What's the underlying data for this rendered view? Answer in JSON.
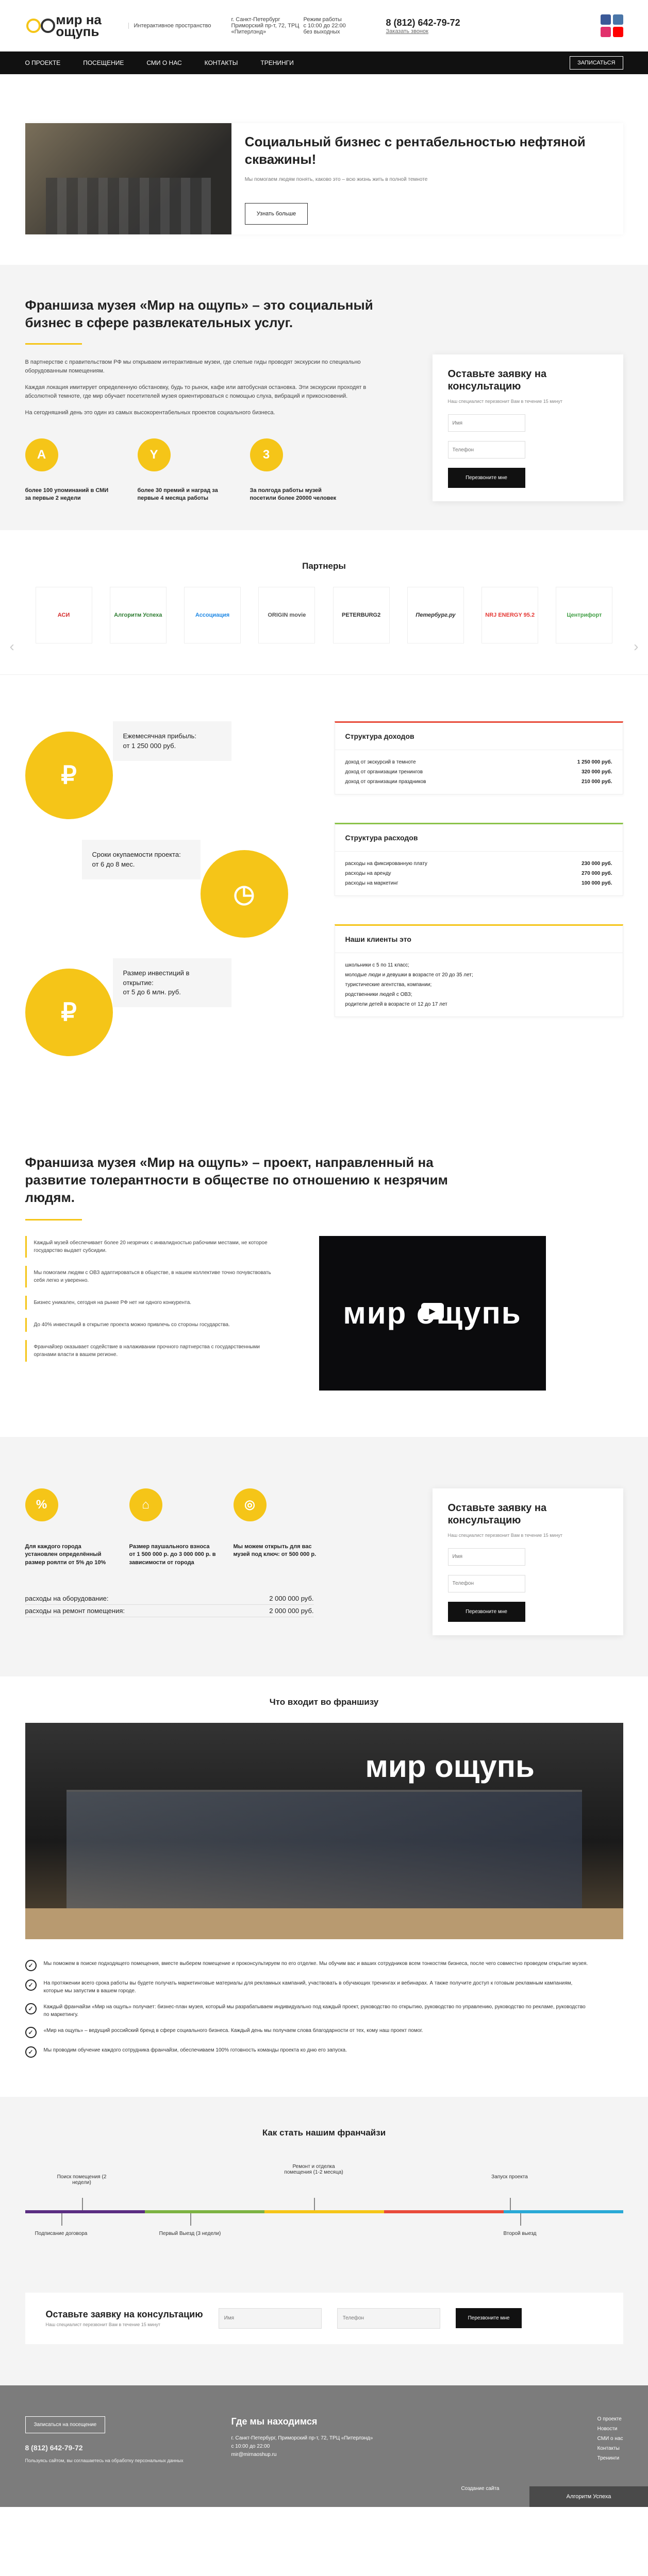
{
  "header": {
    "logo_text": "мир на ощупь",
    "slogan": "Интерактивное пространство",
    "address_city": "г. Санкт-Петербург",
    "address_street": "Приморский пр-т, 72, ТРЦ «Питерлэнд»",
    "hours_label": "Режим работы",
    "hours_value": "с 10:00 до 22:00",
    "hours_extra": "без выходных",
    "phone": "8 (812) 642-79-72",
    "callback_link": "Заказать звонок",
    "social_colors": [
      "#3b5998",
      "#4a76a8",
      "#e1306c",
      "#ff0000"
    ]
  },
  "nav": {
    "items": [
      "О проекте",
      "Посещение",
      "СМИ о нас",
      "Контакты",
      "Тренинги"
    ],
    "call_button": "Записаться"
  },
  "hero": {
    "title": "Социальный бизнес с рентабельностью нефтяной скважины!",
    "subtitle": "Мы помогаем людям понять, каково это – всю жизнь жить в полной темноте",
    "button": "Узнать больше"
  },
  "franchise": {
    "title": "Франшиза музея «Мир на ощупь» – это социальный бизнес в сфере развлекательных услуг.",
    "p1": "В партнерстве с правительством РФ мы открываем интерактивные музеи, где слепые гиды проводят экскурсии по специально оборудованным помещениям.",
    "p2": "Каждая локация имитирует определенную обстановку, будь то рынок, кафе или автобусная остановка. Эти экскурсии проходят в абсолютной темноте, где мир обучает посетителей музея ориентироваться с помощью слуха, вибраций и прикосновений.",
    "p3": "На сегодняшний день это один из самых высокорентабельных проектов социального бизнеса.",
    "stats": [
      {
        "icon": "А",
        "text": "более 100 упоминаний в СМИ за первые 2 недели"
      },
      {
        "icon": "Y",
        "text": "более 30 премий и наград за первые 4 месяца работы"
      },
      {
        "icon": "3",
        "text": "За полгода работы музей посетили более 20000 человек"
      }
    ]
  },
  "form": {
    "title": "Оставьте заявку на консультацию",
    "subtitle": "Наш специалист перезвонит Вам в течение 15 минут",
    "name_placeholder": "Имя",
    "phone_placeholder": "Телефон",
    "send": "Перезвоните мне"
  },
  "partners": {
    "title": "Партнеры",
    "items": [
      "АСИ",
      "Алгоритм Успеха",
      "Ассоциация",
      "ORIGIN movie",
      "PETERBURG2",
      "Петербург.ру",
      "NRJ ENERGY 95.2",
      "Центрифорт"
    ]
  },
  "income": {
    "blocks": [
      {
        "label": "Ежемесячная прибыль:",
        "value": "от 1 250 000 руб.",
        "icon": "₽"
      },
      {
        "label": "Сроки окупаемости проекта:",
        "value": "от 6 до 8 мес.",
        "icon": "◷"
      },
      {
        "label": "Размер инвестиций в открытие:",
        "value": "от 5 до 6 млн. руб.",
        "icon": "₽"
      }
    ],
    "revenue": {
      "title": "Структура доходов",
      "rows": [
        {
          "k": "доход от экскурсий в темноте",
          "v": "1 250 000 руб."
        },
        {
          "k": "доход от организации тренингов",
          "v": "320 000 руб."
        },
        {
          "k": "доход от организации праздников",
          "v": "210 000 руб."
        }
      ]
    },
    "expenses": {
      "title": "Структура расходов",
      "rows": [
        {
          "k": "расходы на фиксированную плату",
          "v": "230 000 руб."
        },
        {
          "k": "расходы на аренду",
          "v": "270 000 руб."
        },
        {
          "k": "расходы на маркетинг",
          "v": "100 000 руб."
        }
      ]
    },
    "clients": {
      "title": "Наши клиенты это",
      "rows": [
        "школьники с 5 по 11 класс;",
        "молодые люди и девушки в возрасте от 20 до 35 лет;",
        "туристические агентства, компании;",
        "родственники людей с ОВЗ;",
        "родители детей в возрасте от 12 до 17 лет"
      ]
    }
  },
  "social": {
    "title": "Франшиза музея «Мир на ощупь» – проект, направленный на развитие толерантности в обществе по отношению к незрячим людям.",
    "items": [
      "Каждый музей обеспечивает более 20 незрячих с инвалидностью рабочими местами, не которое государство выдает субсидии.",
      "Мы помогаем людям с ОВЗ адаптироваться в обществе, в нашем коллективе точно почувствовать себя легко и уверенно.",
      "Бизнес уникален, сегодня на рынке РФ нет ни одного конкурента.",
      "До 40% инвестиций в открытие проекта можно привлечь со стороны государства.",
      "Франчайзер оказывает содействие в налаживании прочного партнерства с государственными органами власти в вашем регионе."
    ],
    "video_logo": "мир ощупь"
  },
  "invest": {
    "stats": [
      {
        "icon": "%",
        "text": "Для каждого города установлен определённый размер роялти от 5% до 10%"
      },
      {
        "icon": "⌂",
        "text": "Размер паушального взноса от 1 500 000 р. до 3 000 000 р. в зависимости от города"
      },
      {
        "icon": "◎",
        "text": "Мы можем открыть для вас музей под ключ: от 500 000 р."
      }
    ],
    "rows": [
      {
        "k": "расходы на оборудование:",
        "v": "2 000 000 руб."
      },
      {
        "k": "расходы на ремонт помещения:",
        "v": "2 000 000 руб."
      }
    ]
  },
  "included": {
    "title": "Что входит во франшизу",
    "store_sign": "мир ощупь",
    "items": [
      "Мы поможем в поиске подходящего помещения, вместе выберем помещение и проконсультируем по его отделке. Мы обучим вас и ваших сотрудников всем тонкостям бизнеса, после чего совместно проведем открытие музея.",
      "На протяжении всего срока работы вы будете получать маркетинговые материалы для рекламных кампаний, участвовать в обучающих тренингах и вебинарах. А также получите доступ к готовым рекламным кампаниям, которые мы запустим в вашем городе.",
      "Каждый франчайзи «Мир на ощупь» получает: бизнес-план музея, который мы разрабатываем индивидуально под каждый проект, руководство по открытию, руководство по управлению, руководство по рекламе, руководство по маркетингу.",
      "«Мир на ощупь» – ведущий российский бренд в сфере социального бизнеса. Каждый день мы получаем слова благодарности от тех, кому наш проект помог.",
      "Мы проводим обучение каждого сотрудника франчайзи, обеспечиваем 100% готовность команды проекта ко дню его запуска."
    ]
  },
  "stages": {
    "title": "Как стать нашим франчайзи",
    "top": [
      "Поиск помещения (2 недели)",
      "Ремонт и отделка помещения (1-2 месяца)",
      "Запуск проекта"
    ],
    "bottom": [
      "Подписание договора",
      "Первый Выезд (3 недели)",
      "Второй выезд"
    ]
  },
  "footer_form": {
    "title": "Оставьте заявку на консультацию",
    "subtitle": "Наш специалист перезвонит Вам в течение 15 минут",
    "name_placeholder": "Имя",
    "phone_placeholder": "Телефон",
    "send": "Перезвоните мне"
  },
  "footer": {
    "call_button": "Записаться на посещение",
    "phone": "8 (812) 642-79-72",
    "note": "Пользуясь сайтом, вы соглашаетесь на обработку персональных данных",
    "where_title": "Где мы находимся",
    "where_text": "г. Санкт-Петербург, Приморский пр-т, 72, ТРЦ «Питерлэнд»",
    "hours": "с 10:00 до 22:00",
    "email": "mir@mirnaoshup.ru",
    "links": [
      "О проекте",
      "Новости",
      "СМИ о нас",
      "Контакты",
      "Тренинги"
    ],
    "copyright": "Создание сайта",
    "corner": "Алгоритм Успеха"
  }
}
